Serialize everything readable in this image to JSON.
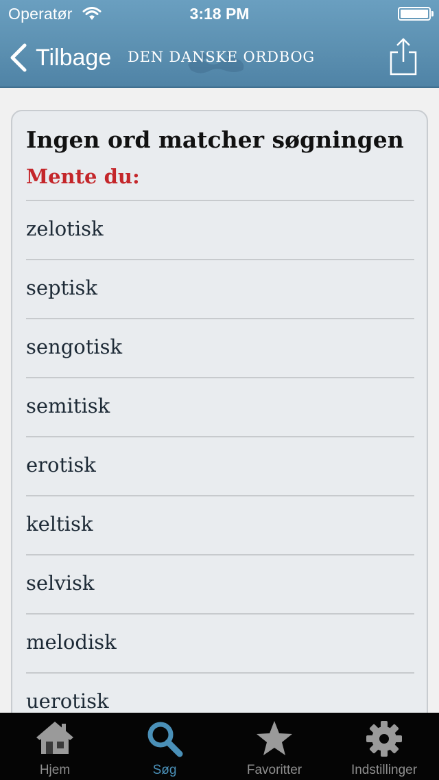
{
  "status_bar": {
    "carrier": "Operatør",
    "time": "3:18 PM"
  },
  "nav": {
    "back_label": "Tilbage",
    "title": "DEN DANSKE ORDBOG",
    "share_icon": "share-icon"
  },
  "result": {
    "heading": "Ingen ord matcher søgningen",
    "suggestion_label": "Mente du:",
    "suggestions": [
      "zelotisk",
      "septisk",
      "sengotisk",
      "semitisk",
      "erotisk",
      "keltisk",
      "selvisk",
      "melodisk",
      "uerotisk"
    ]
  },
  "tabs": [
    {
      "label": "Hjem",
      "icon": "house-icon"
    },
    {
      "label": "Søg",
      "icon": "magnifier-icon"
    },
    {
      "label": "Favoritter",
      "icon": "star-icon"
    },
    {
      "label": "Indstillinger",
      "icon": "gear-icon"
    }
  ],
  "colors": {
    "nav_bar": "#5b8fb0",
    "suggestion_label": "#c4262a",
    "tab_active": "#4a90b8",
    "tab_inactive": "#8e8e8e"
  }
}
